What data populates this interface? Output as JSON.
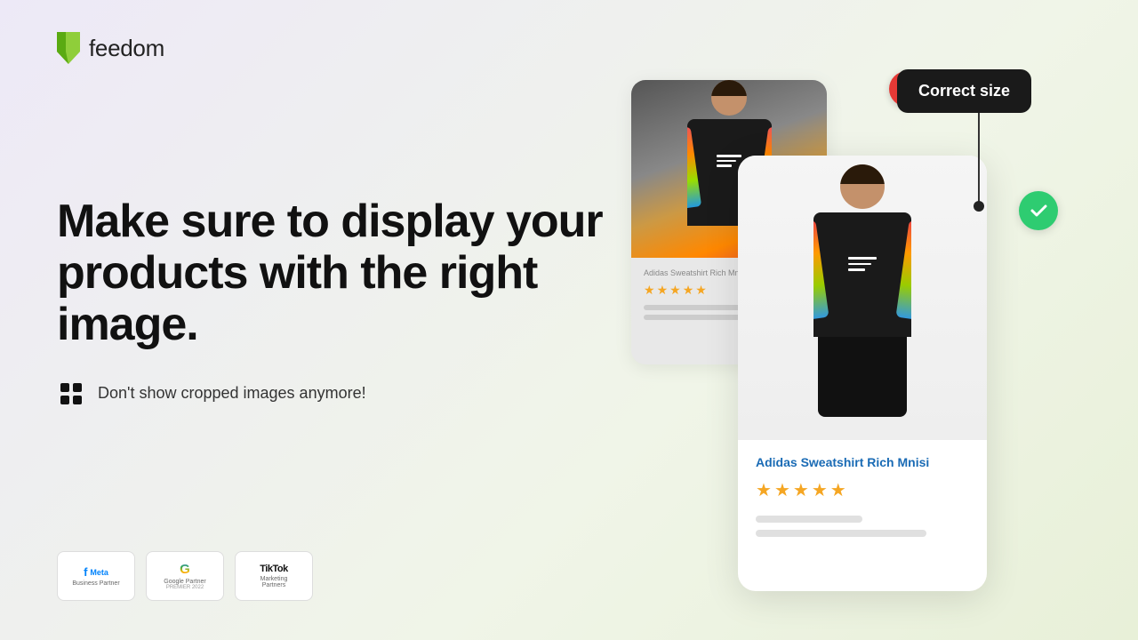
{
  "logo": {
    "text": "feedom"
  },
  "headline": {
    "main": "Make sure to display your products with the right image.",
    "sub": "Don't show cropped images anymore!"
  },
  "partners": [
    {
      "id": "meta",
      "name": "Meta",
      "sub": "Business Partner",
      "symbol": "meta"
    },
    {
      "id": "google",
      "name": "Google Partner",
      "sub": "PREMIER 2022",
      "symbol": "google"
    },
    {
      "id": "tiktok",
      "name": "TikTok",
      "sub": "Marketing Partners",
      "symbol": "tiktok"
    }
  ],
  "illustration": {
    "correct_label": "Correct size",
    "product_name": "Adidas Sweatshirt Rich Mnisi",
    "product_name_back": "Adidas Sweatshirt Rich Mnisi",
    "stars_count": 5,
    "x_label": "wrong",
    "check_label": "correct"
  }
}
